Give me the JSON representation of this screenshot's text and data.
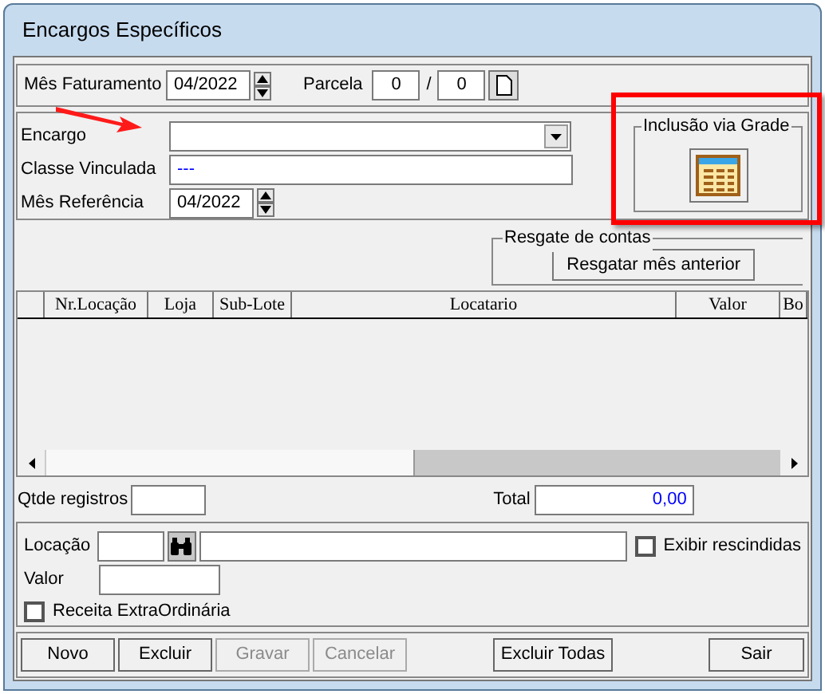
{
  "window": {
    "title": "Encargos Específicos"
  },
  "billing": {
    "label": "Mês Faturamento",
    "value": "04/2022",
    "installment_label": "Parcela",
    "installment": "0",
    "separator": "/",
    "installment_total": "0"
  },
  "charge": {
    "encargo_label": "Encargo",
    "class_label": "Classe Vinculada",
    "class_value": "---",
    "ref_label": "Mês Referência",
    "ref_value": "04/2022"
  },
  "grid_group": {
    "title": "Inclusão via Grade"
  },
  "rescue_group": {
    "title": "Resgate de contas",
    "button": "Resgatar mês anterior"
  },
  "table": {
    "columns": [
      "Nr.Locação",
      "Loja",
      "Sub-Lote",
      "Locatario",
      "Valor",
      "Bo"
    ]
  },
  "totals": {
    "count_label": "Qtde registros",
    "total_label": "Total",
    "total_value": "0,00"
  },
  "entry": {
    "location_label": "Locação",
    "show_rescinded": {
      "label": "Exibir rescindidas",
      "checked": false
    },
    "value_label": "Valor",
    "extraordinary": {
      "label": "Receita ExtraOrdinária",
      "checked": false
    }
  },
  "buttons": [
    {
      "label": "Novo",
      "disabled": false
    },
    {
      "label": "Excluir",
      "disabled": false
    },
    {
      "label": "Gravar",
      "disabled": true
    },
    {
      "label": "Cancelar",
      "disabled": true
    },
    {
      "label": "Excluir Todas",
      "disabled": false
    },
    {
      "label": "Sair",
      "disabled": false
    }
  ]
}
